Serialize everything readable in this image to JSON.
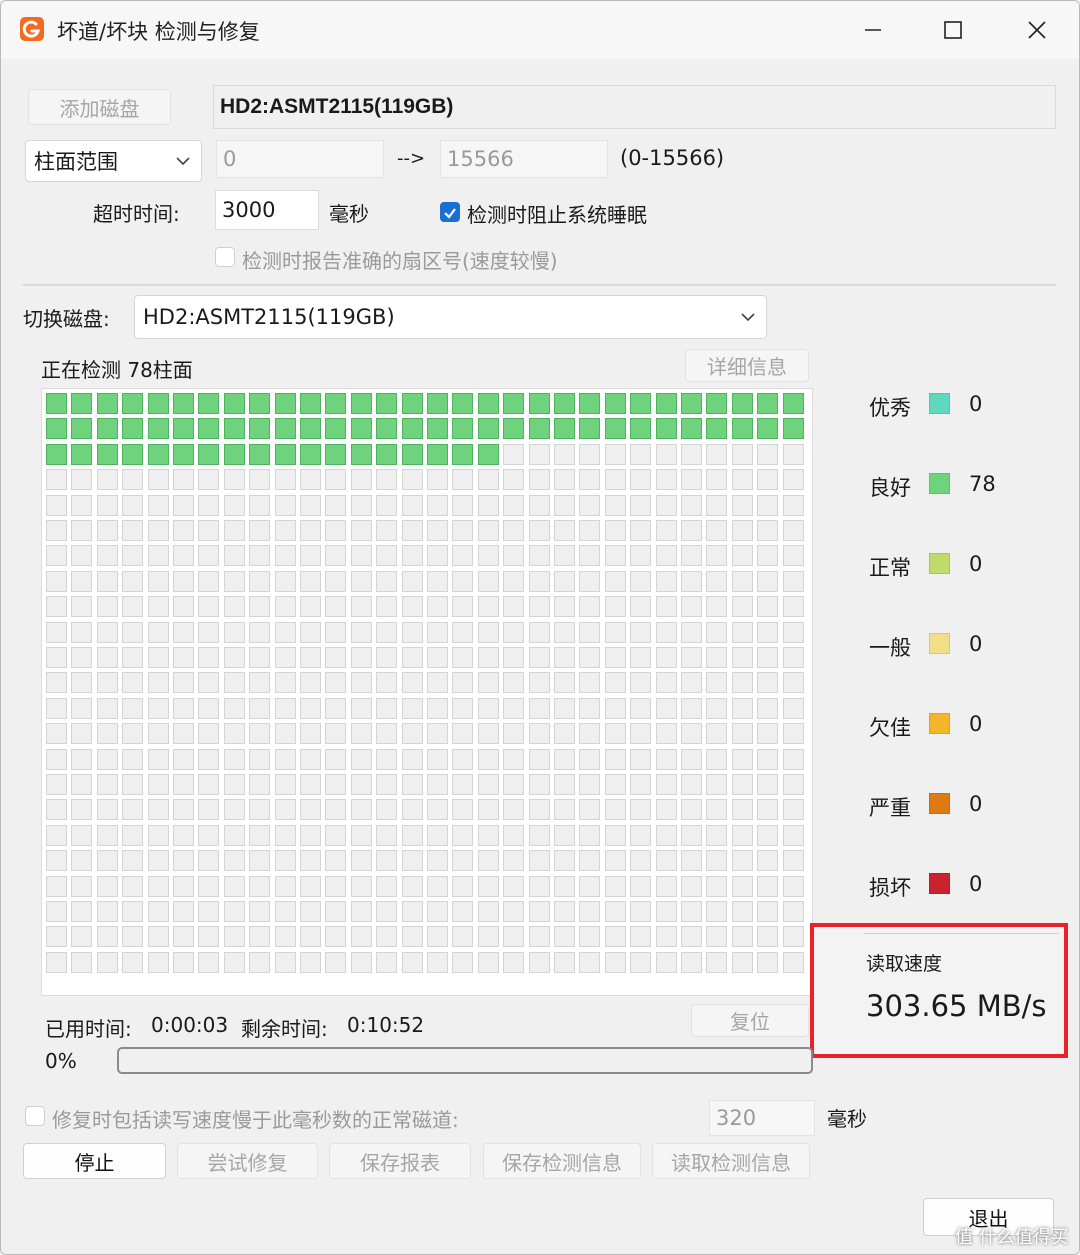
{
  "window": {
    "title": "坏道/坏块 检测与修复",
    "accent_color": "#f26b21"
  },
  "top": {
    "add_disk_button": "添加磁盘",
    "disk_name": "HD2:ASMT2115(119GB)",
    "range_mode": "柱面范围",
    "range_start": "0",
    "range_arrow": "-->",
    "range_end": "15566",
    "range_hint": "(0-15566)",
    "timeout_label": "超时时间:",
    "timeout_value": "3000",
    "timeout_unit": "毫秒",
    "prevent_sleep_label": "检测时阻止系统睡眠",
    "prevent_sleep_checked": true,
    "report_sector_label": "检测时报告准确的扇区号(速度较慢)",
    "report_sector_checked": false
  },
  "switch_disk": {
    "label": "切换磁盘:",
    "value": "HD2:ASMT2115(119GB)"
  },
  "scan": {
    "status_text": "正在检测 78柱面",
    "details_button": "详细信息",
    "grid_columns": 30,
    "grid_rows": 23,
    "cells_checked": 78,
    "good_color": "#6fd27c",
    "empty_color": "#efefef"
  },
  "legend": [
    {
      "name": "优秀",
      "count": "0",
      "color": "#5fd8c0"
    },
    {
      "name": "良好",
      "count": "78",
      "color": "#6fd27c"
    },
    {
      "name": "正常",
      "count": "0",
      "color": "#bddc6a"
    },
    {
      "name": "一般",
      "count": "0",
      "color": "#f1de86"
    },
    {
      "name": "欠佳",
      "count": "0",
      "color": "#f3b62b"
    },
    {
      "name": "严重",
      "count": "0",
      "color": "#dd7a12"
    },
    {
      "name": "损坏",
      "count": "0",
      "color": "#c8232f"
    }
  ],
  "speed": {
    "label": "读取速度",
    "value": "303.65 MB/s",
    "highlight_color": "#e8212a"
  },
  "time": {
    "elapsed_label": "已用时间:",
    "elapsed_value": "0:00:03",
    "remaining_label": "剩余时间:",
    "remaining_value": "0:10:52",
    "reset_button": "复位"
  },
  "progress": {
    "percent_text": "0%",
    "fraction": 0.0
  },
  "repair": {
    "include_slow_label": "修复时包括读写速度慢于此毫秒数的正常磁道:",
    "include_slow_checked": false,
    "threshold_value": "320",
    "threshold_unit": "毫秒"
  },
  "buttons": {
    "stop": "停止",
    "try_repair": "尝试修复",
    "save_report": "保存报表",
    "save_scan_info": "保存检测信息",
    "load_scan_info": "读取检测信息",
    "exit": "退出"
  },
  "watermark": "值 什么值得买"
}
